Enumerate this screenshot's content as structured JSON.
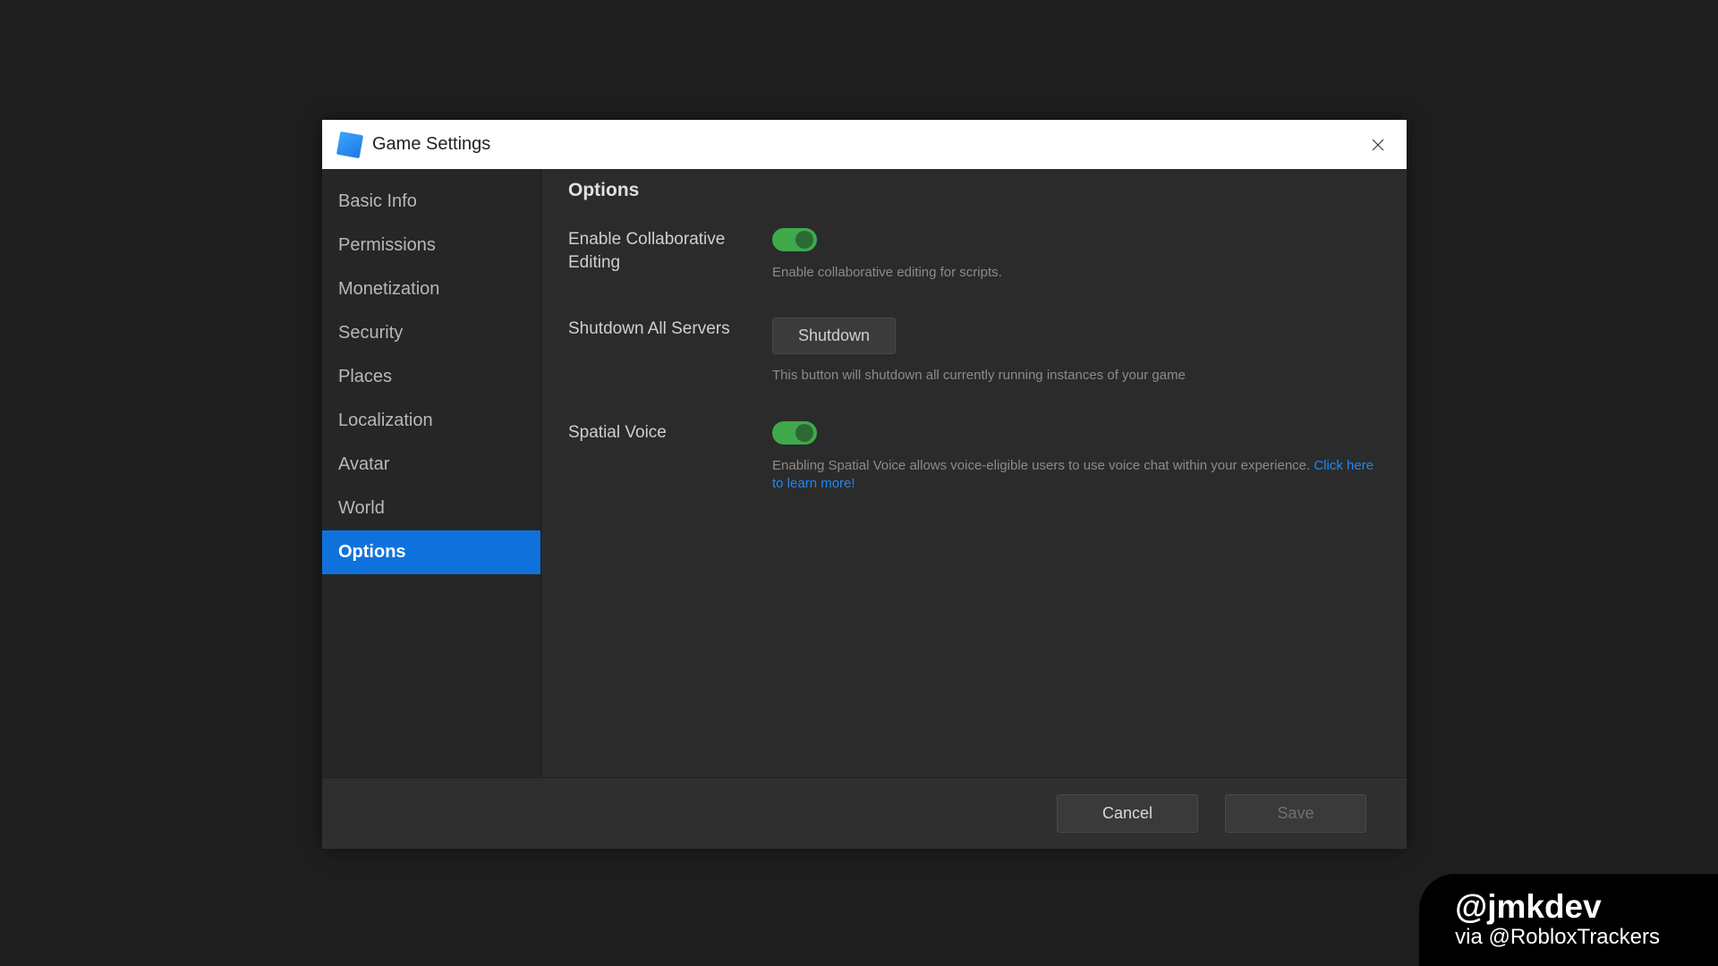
{
  "dialog": {
    "title": "Game Settings"
  },
  "sidebar": {
    "items": [
      {
        "label": "Basic Info"
      },
      {
        "label": "Permissions"
      },
      {
        "label": "Monetization"
      },
      {
        "label": "Security"
      },
      {
        "label": "Places"
      },
      {
        "label": "Localization"
      },
      {
        "label": "Avatar"
      },
      {
        "label": "World"
      },
      {
        "label": "Options"
      }
    ],
    "active_index": 8
  },
  "content": {
    "heading": "Options",
    "collab": {
      "label": "Enable Collaborative Editing",
      "on": true,
      "desc": "Enable collaborative editing for scripts."
    },
    "shutdown": {
      "label": "Shutdown All Servers",
      "button": "Shutdown",
      "desc": "This button will shutdown all currently running instances of your game"
    },
    "spatial": {
      "label": "Spatial Voice",
      "on": true,
      "desc": "Enabling Spatial Voice allows voice-eligible users to use voice chat within your experience. ",
      "link": "Click here to learn more!"
    }
  },
  "footer": {
    "cancel": "Cancel",
    "save": "Save"
  },
  "watermark": {
    "handle": "@jmkdev",
    "via": "via @RobloxTrackers"
  }
}
